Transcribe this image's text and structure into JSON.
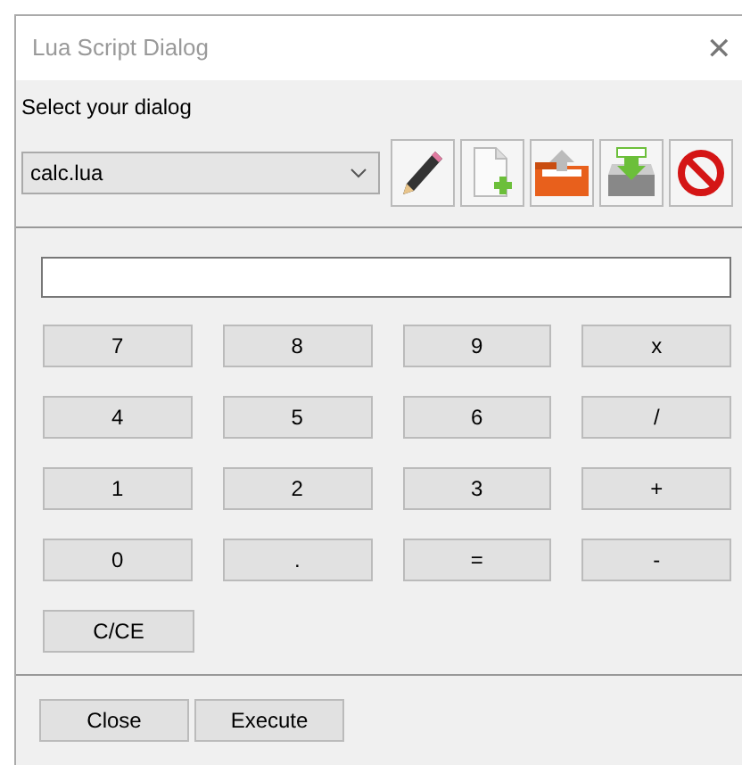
{
  "window": {
    "title": "Lua Script Dialog",
    "close_glyph": "✕"
  },
  "dialog_select": {
    "label": "Select your dialog",
    "value": "calc.lua"
  },
  "toolbar": [
    {
      "kind": "edit"
    },
    {
      "kind": "new"
    },
    {
      "kind": "open"
    },
    {
      "kind": "save"
    },
    {
      "kind": "delete"
    }
  ],
  "keys": [
    [
      "7",
      "8",
      "9",
      "x"
    ],
    [
      "4",
      "5",
      "6",
      "/"
    ],
    [
      "1",
      "2",
      "3",
      "+"
    ],
    [
      "0",
      ".",
      "=",
      "-"
    ],
    [
      "C/CE"
    ]
  ],
  "buttons": [
    "Close",
    "Execute"
  ]
}
